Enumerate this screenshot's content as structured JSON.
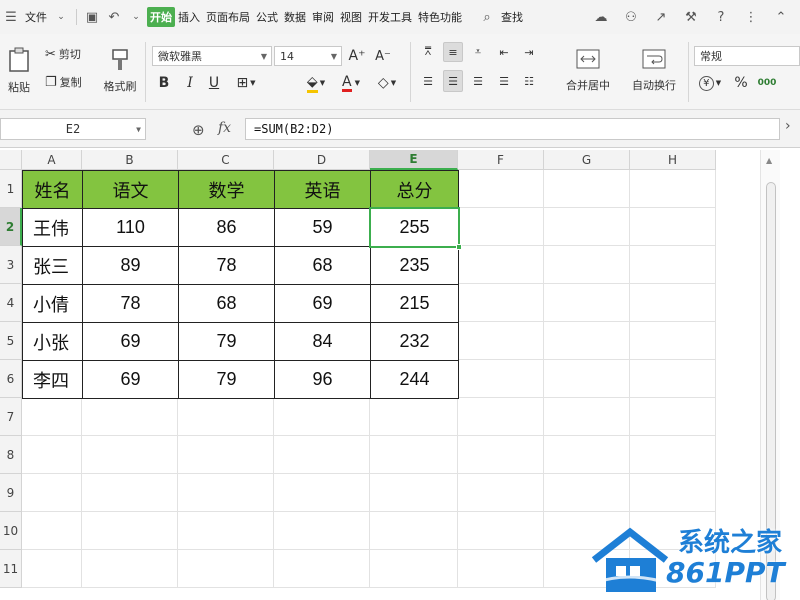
{
  "menubar": {
    "file_label": "文件",
    "items": [
      "开始",
      "插入",
      "页面布局",
      "公式",
      "数据",
      "审阅",
      "视图",
      "开发工具",
      "特色功能"
    ],
    "active_index": 0,
    "search_label": "查找"
  },
  "ribbon": {
    "paste_label": "粘贴",
    "cut_label": "剪切",
    "copy_label": "复制",
    "format_painter_label": "格式刷",
    "font_name": "微软雅黑",
    "font_size": "14",
    "bold": "B",
    "italic": "I",
    "underline": "U",
    "font_color_glyph": "A",
    "grow_font": "A⁺",
    "shrink_font": "A⁻",
    "merge_center_label": "合并居中",
    "wrap_text_label": "自动换行",
    "number_format": "常规",
    "currency_glyph": "¥",
    "percent_glyph": "%"
  },
  "formula_bar": {
    "name_box": "E2",
    "fx_label": "fx",
    "formula": "=SUM(B2:D2)"
  },
  "sheet": {
    "columns": [
      "A",
      "B",
      "C",
      "D",
      "E",
      "F",
      "G",
      "H"
    ],
    "selected_column": "E",
    "rows": [
      "1",
      "2",
      "3",
      "4",
      "5",
      "6",
      "7",
      "8",
      "9",
      "10",
      "11"
    ],
    "selected_row": "2",
    "active_cell": "E2",
    "table": {
      "header": [
        "姓名",
        "语文",
        "数学",
        "英语",
        "总分"
      ],
      "rows": [
        [
          "王伟",
          "110",
          "86",
          "59",
          "255"
        ],
        [
          "张三",
          "89",
          "78",
          "68",
          "235"
        ],
        [
          "小倩",
          "78",
          "68",
          "69",
          "215"
        ],
        [
          "小张",
          "69",
          "79",
          "84",
          "232"
        ],
        [
          "李四",
          "69",
          "79",
          "96",
          "244"
        ]
      ]
    }
  },
  "watermark": {
    "line1": "系统之家",
    "line2": "861PPT"
  },
  "colors": {
    "header_fill": "#83c440",
    "accent_green": "#3cae4e",
    "tab_active": "#4caf50"
  }
}
